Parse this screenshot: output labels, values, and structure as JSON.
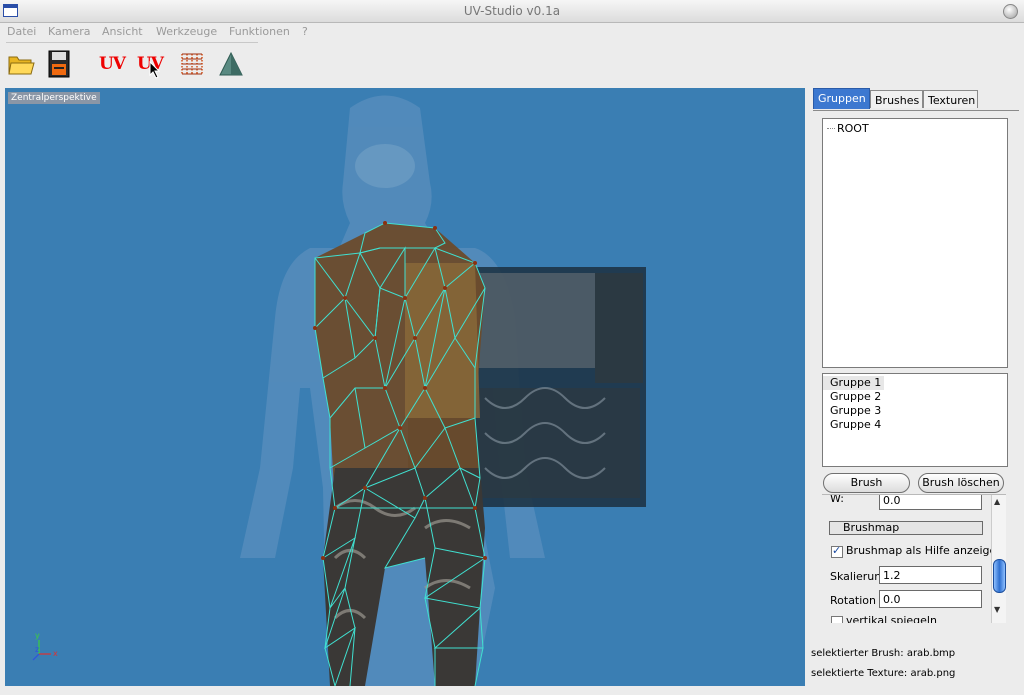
{
  "window": {
    "title": "UV-Studio v0.1a"
  },
  "menu": [
    "Datei",
    "Kamera",
    "Ansicht",
    "Werkzeuge",
    "Funktionen",
    "?"
  ],
  "toolbar": {
    "buttons": [
      "open-folder",
      "save-disk",
      "uv-mode",
      "uv-edit",
      "texture-grid",
      "triangle"
    ],
    "uv_label_1": "UV",
    "uv_label_2": "UV"
  },
  "viewport": {
    "label": "Zentralperspektive",
    "axes": {
      "x": "x",
      "y": "y",
      "z": "z"
    }
  },
  "tabs": [
    {
      "label": "Gruppen",
      "active": true
    },
    {
      "label": "Brushes",
      "active": false
    },
    {
      "label": "Texturen",
      "active": false
    }
  ],
  "tree": {
    "root": "ROOT"
  },
  "groups": [
    "Gruppe 1",
    "Gruppe 2",
    "Gruppe 3",
    "Gruppe 4"
  ],
  "buttons": {
    "assign": "Brush zuweisen",
    "delete": "Brush löschen"
  },
  "props": {
    "w_label": "W:",
    "w_value": "0.0",
    "brushmap_label": "Brushmap",
    "show_brushmap_label": "Brushmap als Hilfe anzeigen",
    "show_brushmap_checked": true,
    "scale_label": "Skalierun",
    "scale_value": "1.2",
    "rotation_label": "Rotation",
    "rotation_value": "0.0",
    "flip_vertical_label": "vertikal spiegeln",
    "flip_vertical_checked": false
  },
  "status": {
    "brush": "selektierter Brush: arab.bmp",
    "texture": "selektierte Texture: arab.png"
  },
  "colors": {
    "viewport_bg": "#3a7eb3",
    "wireframe": "#40e0d0",
    "active_tab": "#3c78d0"
  }
}
